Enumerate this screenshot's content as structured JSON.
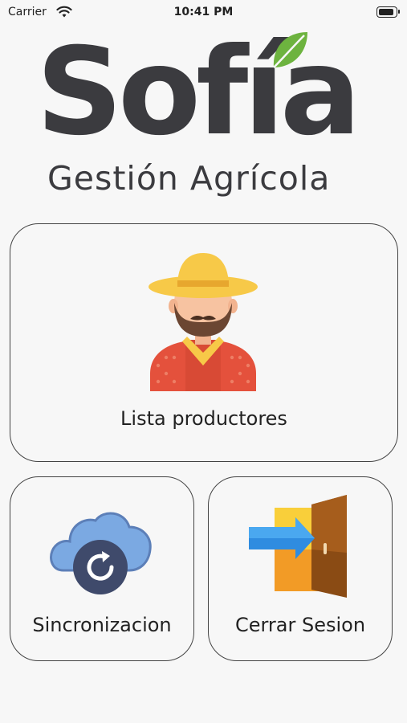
{
  "status_bar": {
    "carrier": "Carrier",
    "time": "10:41 PM"
  },
  "logo": {
    "title": "Sofía",
    "subtitle": "Gestión Agrícola"
  },
  "menu": {
    "producers_label": "Lista productores",
    "sync_label": "Sincronizacion",
    "logout_label": "Cerrar Sesion"
  },
  "colors": {
    "logo_text": "#3b3b3f",
    "leaf": "#6db33f",
    "hat": "#f7c948",
    "shirt": "#e4513c",
    "cloud": "#7ba9e2",
    "sync_badge": "#3f4a6b",
    "door": "#8a4b14",
    "arrow": "#2f8ce0"
  },
  "icons": [
    "wifi-icon",
    "battery-icon",
    "farmer-icon",
    "cloud-sync-icon",
    "logout-door-icon"
  ]
}
